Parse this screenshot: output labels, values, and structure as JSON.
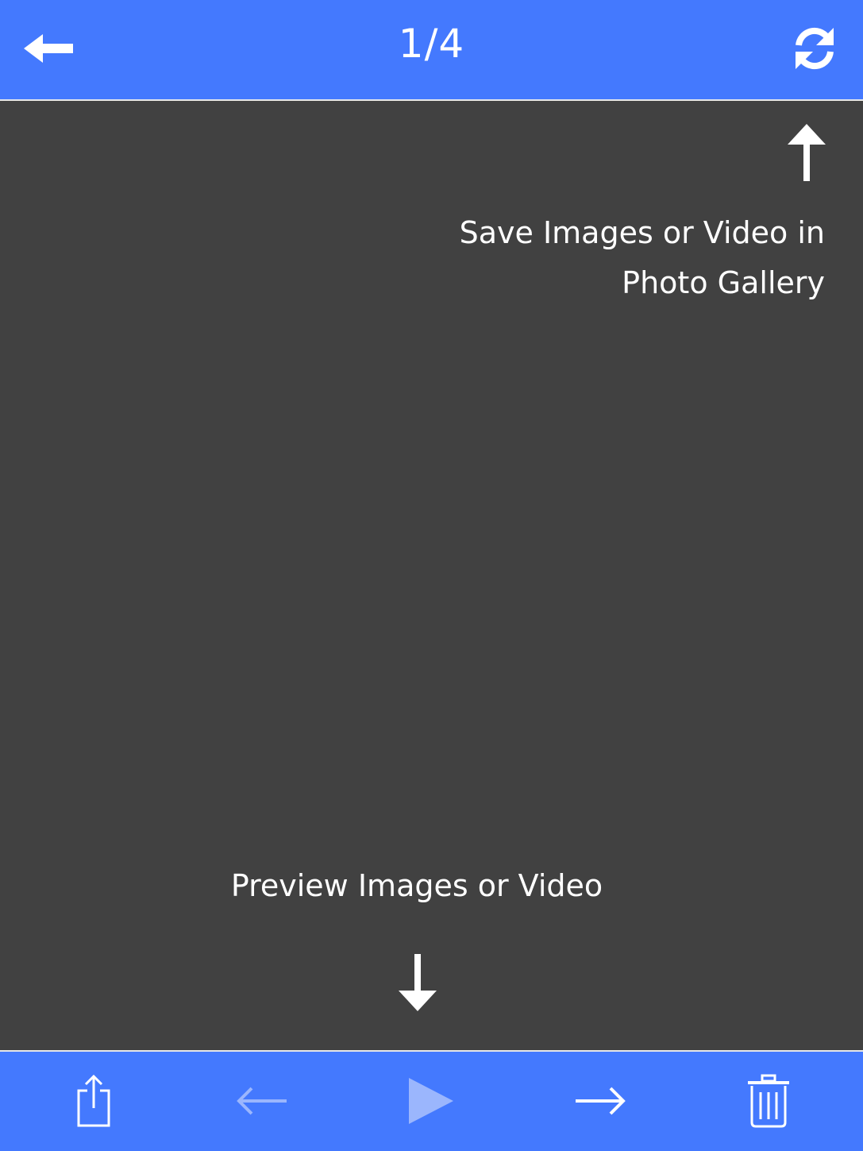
{
  "header": {
    "page_indicator": "1/4",
    "back_icon": "back-arrow-icon",
    "refresh_icon": "refresh-icon"
  },
  "main": {
    "save_hint_line1": "Save Images or Video in",
    "save_hint_line2": "Photo Gallery",
    "preview_hint": "Preview Images or Video"
  },
  "toolbar": {
    "icons": [
      "share-icon",
      "previous-icon",
      "play-icon",
      "next-icon",
      "trash-icon"
    ]
  },
  "colors": {
    "accent": "#4479fe",
    "background": "#414141",
    "foreground": "#ffffff",
    "disabled_icon": "#9bb6fd"
  }
}
